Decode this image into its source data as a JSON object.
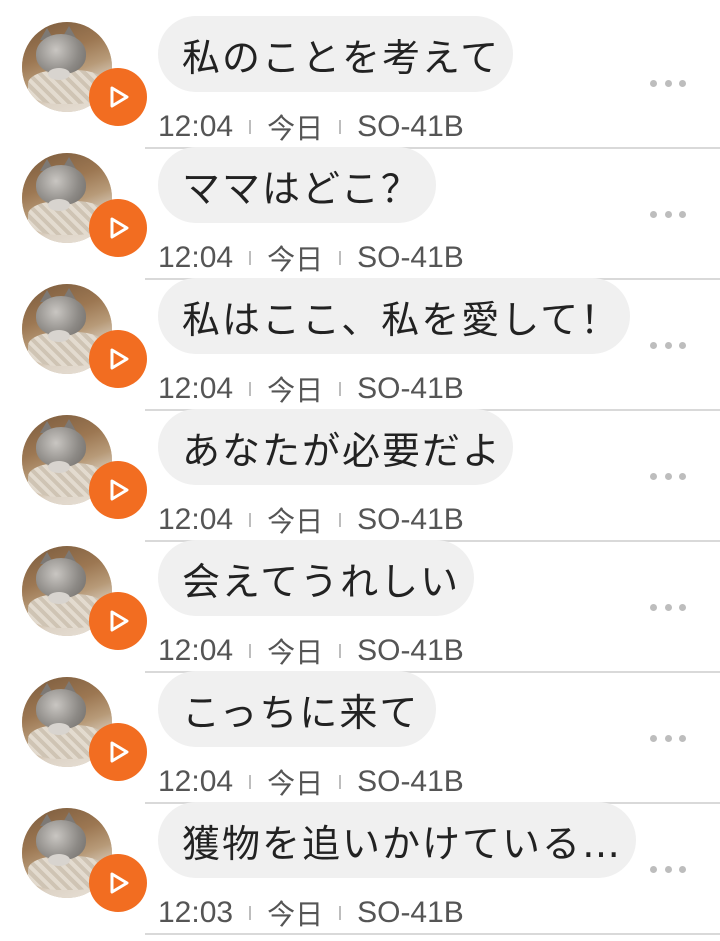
{
  "colors": {
    "accent": "#f26d21",
    "bubble_bg": "#f0f0f0",
    "divider": "#d9d9d9"
  },
  "icons": {
    "avatar": "cat-avatar-icon",
    "play": "play-icon",
    "more": "more-horizontal-icon"
  },
  "messages": [
    {
      "text": "私のことを考えて",
      "time": "12:04",
      "day": "今日",
      "device": "SO-41B"
    },
    {
      "text": "ママはどこ？",
      "time": "12:04",
      "day": "今日",
      "device": "SO-41B"
    },
    {
      "text": "私はここ、私を愛して！",
      "time": "12:04",
      "day": "今日",
      "device": "SO-41B"
    },
    {
      "text": "あなたが必要だよ",
      "time": "12:04",
      "day": "今日",
      "device": "SO-41B"
    },
    {
      "text": "会えてうれしい",
      "time": "12:04",
      "day": "今日",
      "device": "SO-41B"
    },
    {
      "text": "こっちに来て",
      "time": "12:04",
      "day": "今日",
      "device": "SO-41B"
    },
    {
      "text": "獲物を追いかけている…",
      "time": "12:03",
      "day": "今日",
      "device": "SO-41B"
    }
  ]
}
